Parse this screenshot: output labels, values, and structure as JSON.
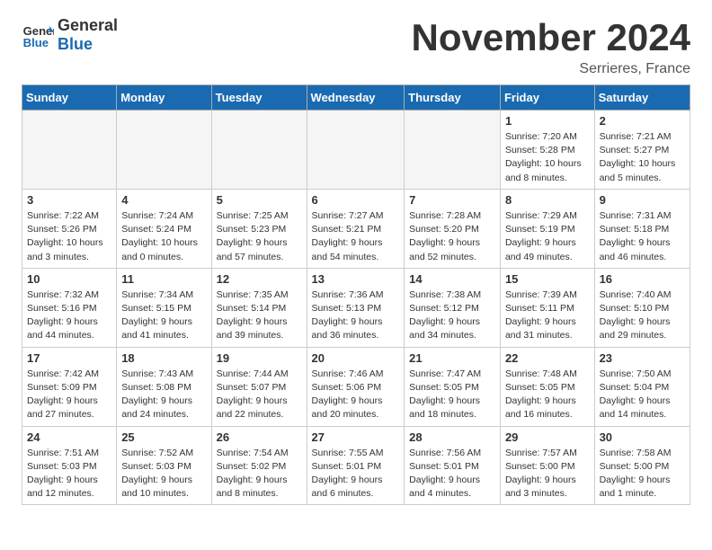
{
  "header": {
    "logo_line1": "General",
    "logo_line2": "Blue",
    "month_title": "November 2024",
    "location": "Serrieres, France"
  },
  "weekdays": [
    "Sunday",
    "Monday",
    "Tuesday",
    "Wednesday",
    "Thursday",
    "Friday",
    "Saturday"
  ],
  "weeks": [
    [
      {
        "day": "",
        "info": ""
      },
      {
        "day": "",
        "info": ""
      },
      {
        "day": "",
        "info": ""
      },
      {
        "day": "",
        "info": ""
      },
      {
        "day": "",
        "info": ""
      },
      {
        "day": "1",
        "info": "Sunrise: 7:20 AM\nSunset: 5:28 PM\nDaylight: 10 hours\nand 8 minutes."
      },
      {
        "day": "2",
        "info": "Sunrise: 7:21 AM\nSunset: 5:27 PM\nDaylight: 10 hours\nand 5 minutes."
      }
    ],
    [
      {
        "day": "3",
        "info": "Sunrise: 7:22 AM\nSunset: 5:26 PM\nDaylight: 10 hours\nand 3 minutes."
      },
      {
        "day": "4",
        "info": "Sunrise: 7:24 AM\nSunset: 5:24 PM\nDaylight: 10 hours\nand 0 minutes."
      },
      {
        "day": "5",
        "info": "Sunrise: 7:25 AM\nSunset: 5:23 PM\nDaylight: 9 hours\nand 57 minutes."
      },
      {
        "day": "6",
        "info": "Sunrise: 7:27 AM\nSunset: 5:21 PM\nDaylight: 9 hours\nand 54 minutes."
      },
      {
        "day": "7",
        "info": "Sunrise: 7:28 AM\nSunset: 5:20 PM\nDaylight: 9 hours\nand 52 minutes."
      },
      {
        "day": "8",
        "info": "Sunrise: 7:29 AM\nSunset: 5:19 PM\nDaylight: 9 hours\nand 49 minutes."
      },
      {
        "day": "9",
        "info": "Sunrise: 7:31 AM\nSunset: 5:18 PM\nDaylight: 9 hours\nand 46 minutes."
      }
    ],
    [
      {
        "day": "10",
        "info": "Sunrise: 7:32 AM\nSunset: 5:16 PM\nDaylight: 9 hours\nand 44 minutes."
      },
      {
        "day": "11",
        "info": "Sunrise: 7:34 AM\nSunset: 5:15 PM\nDaylight: 9 hours\nand 41 minutes."
      },
      {
        "day": "12",
        "info": "Sunrise: 7:35 AM\nSunset: 5:14 PM\nDaylight: 9 hours\nand 39 minutes."
      },
      {
        "day": "13",
        "info": "Sunrise: 7:36 AM\nSunset: 5:13 PM\nDaylight: 9 hours\nand 36 minutes."
      },
      {
        "day": "14",
        "info": "Sunrise: 7:38 AM\nSunset: 5:12 PM\nDaylight: 9 hours\nand 34 minutes."
      },
      {
        "day": "15",
        "info": "Sunrise: 7:39 AM\nSunset: 5:11 PM\nDaylight: 9 hours\nand 31 minutes."
      },
      {
        "day": "16",
        "info": "Sunrise: 7:40 AM\nSunset: 5:10 PM\nDaylight: 9 hours\nand 29 minutes."
      }
    ],
    [
      {
        "day": "17",
        "info": "Sunrise: 7:42 AM\nSunset: 5:09 PM\nDaylight: 9 hours\nand 27 minutes."
      },
      {
        "day": "18",
        "info": "Sunrise: 7:43 AM\nSunset: 5:08 PM\nDaylight: 9 hours\nand 24 minutes."
      },
      {
        "day": "19",
        "info": "Sunrise: 7:44 AM\nSunset: 5:07 PM\nDaylight: 9 hours\nand 22 minutes."
      },
      {
        "day": "20",
        "info": "Sunrise: 7:46 AM\nSunset: 5:06 PM\nDaylight: 9 hours\nand 20 minutes."
      },
      {
        "day": "21",
        "info": "Sunrise: 7:47 AM\nSunset: 5:05 PM\nDaylight: 9 hours\nand 18 minutes."
      },
      {
        "day": "22",
        "info": "Sunrise: 7:48 AM\nSunset: 5:05 PM\nDaylight: 9 hours\nand 16 minutes."
      },
      {
        "day": "23",
        "info": "Sunrise: 7:50 AM\nSunset: 5:04 PM\nDaylight: 9 hours\nand 14 minutes."
      }
    ],
    [
      {
        "day": "24",
        "info": "Sunrise: 7:51 AM\nSunset: 5:03 PM\nDaylight: 9 hours\nand 12 minutes."
      },
      {
        "day": "25",
        "info": "Sunrise: 7:52 AM\nSunset: 5:03 PM\nDaylight: 9 hours\nand 10 minutes."
      },
      {
        "day": "26",
        "info": "Sunrise: 7:54 AM\nSunset: 5:02 PM\nDaylight: 9 hours\nand 8 minutes."
      },
      {
        "day": "27",
        "info": "Sunrise: 7:55 AM\nSunset: 5:01 PM\nDaylight: 9 hours\nand 6 minutes."
      },
      {
        "day": "28",
        "info": "Sunrise: 7:56 AM\nSunset: 5:01 PM\nDaylight: 9 hours\nand 4 minutes."
      },
      {
        "day": "29",
        "info": "Sunrise: 7:57 AM\nSunset: 5:00 PM\nDaylight: 9 hours\nand 3 minutes."
      },
      {
        "day": "30",
        "info": "Sunrise: 7:58 AM\nSunset: 5:00 PM\nDaylight: 9 hours\nand 1 minute."
      }
    ]
  ]
}
